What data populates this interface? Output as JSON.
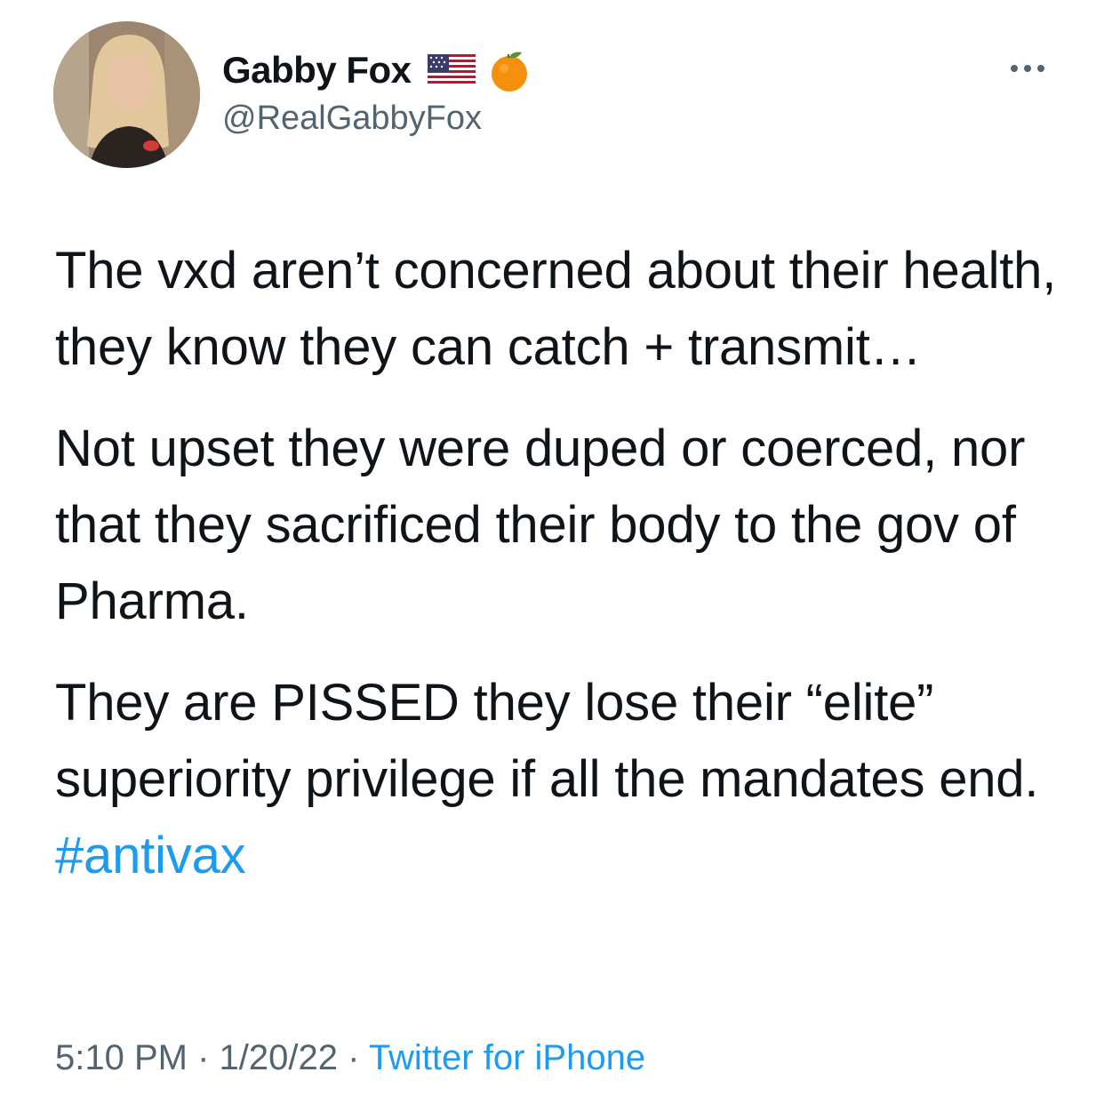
{
  "user": {
    "display_name": "Gabby Fox",
    "handle": "@RealGabbyFox",
    "badges": [
      "us-flag-icon",
      "orange-icon"
    ]
  },
  "tweet": {
    "paragraphs": [
      "The vxd aren’t concerned about their health, they know they can catch + transmit…",
      "Not upset they were duped or coerced, nor that they sacrificed their body to the gov of Pharma.",
      "They are PISSED they lose their “elite” superiority privilege if all the mandates end."
    ],
    "hashtag": "#antivax"
  },
  "meta": {
    "time": "5:10 PM",
    "separator1": " · ",
    "date": "1/20/22",
    "separator2": " · ",
    "source": "Twitter for iPhone"
  },
  "colors": {
    "text": "#0f1419",
    "secondary": "#536471",
    "link": "#1d9bf0"
  }
}
